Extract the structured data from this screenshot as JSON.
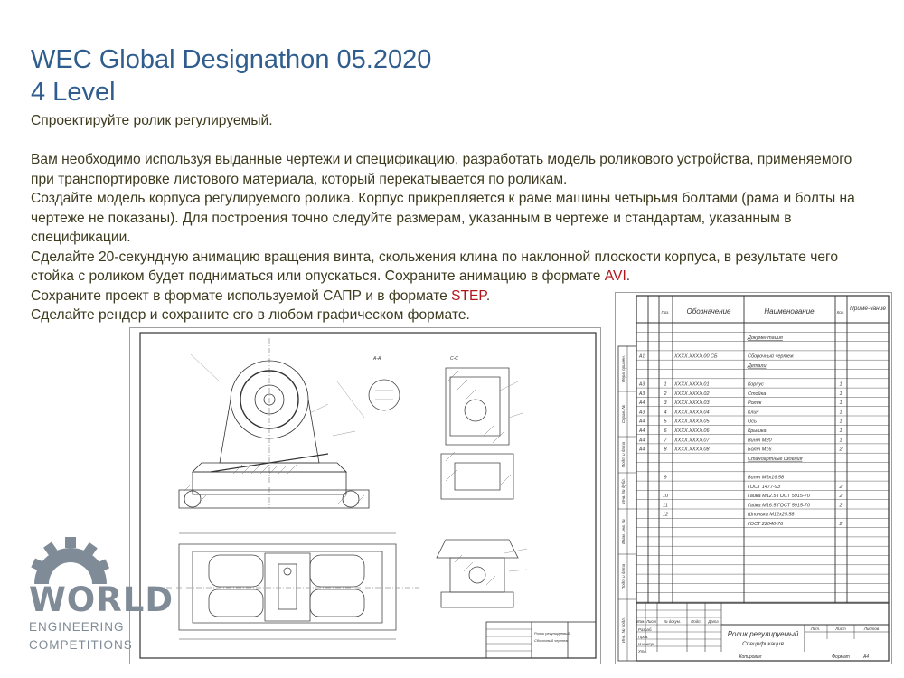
{
  "header": {
    "title_line1": "WEC Global Designathon 05.2020",
    "title_line2": "4 Level"
  },
  "task": {
    "intro": "Спроектируйте ролик регулируемый.",
    "p1": "Вам необходимо используя выданные чертежи и спецификацию, разработать модель роликового устройства, применяемого при транспортировке листового материала, который перекатывается по роликам.",
    "p2": "Создайте модель корпуса регулируемого ролика. Корпус прикрепляется к раме машины четырьмя болтами (рама и болты на чертеже не показаны). Для построения точно следуйте размерам, указанным в чертеже и стандартам, указанным в спецификации.",
    "p3_before": "Сделайте 20-секундную анимацию вращения винта, скольжения клина по наклонной плоскости корпуса, в результате чего стойка с роликом будет подниматься или опускаться. Сохраните анимацию в формате ",
    "p3_accent": "AVI",
    "p3_after": ".",
    "p4_before": "Сохраните проект в формате используемой САПР и в формате ",
    "p4_accent": "STEP",
    "p4_after": ".",
    "p5": "Сделайте рендер и сохраните его в любом графическом формате."
  },
  "colors": {
    "title": "#2f5d8e",
    "text": "#3d3a1e",
    "accent": "#b0161c",
    "logo": "#7f8b96"
  },
  "drawing": {
    "section_aa": "А-А",
    "section_cc": "С-С",
    "stamp_name": "Ролик регулируемый",
    "stamp_sub": "Сборочный чертеж"
  },
  "spec": {
    "headers": {
      "designation": "Обозначение",
      "name": "Наименование",
      "qty": "Кол.",
      "note": "Приме-чание",
      "pos": "Поз."
    },
    "side_labels": [
      "Перв. примен.",
      "Справ. №",
      "Подп. и дата",
      "Инв. № дубл.",
      "Взам. инв. №",
      "Подп. и дата",
      "Инв. № подл."
    ],
    "rows": [
      {
        "pos": "",
        "des": "",
        "name": "Документация",
        "qty": "",
        "hdr": true
      },
      {
        "pos": "",
        "des": "ХХХХ.ХХХХ.00 СБ",
        "name": "Сборочный чертеж",
        "qty": "",
        "fmt": "А1"
      },
      {
        "pos": "",
        "des": "",
        "name": "Детали",
        "qty": "",
        "hdr": true
      },
      {
        "pos": "1",
        "des": "ХХХХ.ХХХХ.01",
        "name": "Корпус",
        "qty": "1",
        "fmt": "А3"
      },
      {
        "pos": "2",
        "des": "ХХХХ.ХХХХ.02",
        "name": "Стойка",
        "qty": "1",
        "fmt": "А3"
      },
      {
        "pos": "3",
        "des": "ХХХХ.ХХХХ.03",
        "name": "Ролик",
        "qty": "1",
        "fmt": "А4"
      },
      {
        "pos": "4",
        "des": "ХХХХ.ХХХХ.04",
        "name": "Клин",
        "qty": "1",
        "fmt": "А3"
      },
      {
        "pos": "5",
        "des": "ХХХХ.ХХХХ.05",
        "name": "Ось",
        "qty": "1",
        "fmt": "А4"
      },
      {
        "pos": "6",
        "des": "ХХХХ.ХХХХ.06",
        "name": "Крышка",
        "qty": "1",
        "fmt": "А4"
      },
      {
        "pos": "7",
        "des": "ХХХХ.ХХХХ.07",
        "name": "Винт М20",
        "qty": "1",
        "fmt": "А4"
      },
      {
        "pos": "8",
        "des": "ХХХХ.ХХХХ.08",
        "name": "Болт М16",
        "qty": "2",
        "fmt": "А4"
      },
      {
        "pos": "",
        "des": "",
        "name": "Стандартные изделия",
        "qty": "",
        "hdr": true
      },
      {
        "pos": "9",
        "des": "",
        "name": "Винт М6х16.58",
        "qty": ""
      },
      {
        "pos": "",
        "des": "",
        "name": "ГОСТ 1477-93",
        "qty": "2"
      },
      {
        "pos": "10",
        "des": "",
        "name": "Гайка М12.5 ГОСТ 5915-70",
        "qty": "2"
      },
      {
        "pos": "11",
        "des": "",
        "name": "Гайка М16.5 ГОСТ 5915-70",
        "qty": "2"
      },
      {
        "pos": "12",
        "des": "",
        "name": "Шпилька М12х25.58",
        "qty": ""
      },
      {
        "pos": "",
        "des": "",
        "name": "ГОСТ 22040-76",
        "qty": "2"
      }
    ],
    "stamp": {
      "title": "Ролик регулируемый",
      "subtitle": "Спецификация",
      "cols": [
        "Изм.",
        "Лист",
        "№ докум.",
        "Подп.",
        "Дата"
      ],
      "roles": [
        "Разраб.",
        "Пров.",
        "Н.контр.",
        "Утв."
      ],
      "lit": "Лит.",
      "sheet": "Лист",
      "sheets": "Листов",
      "copied": "Копировал",
      "format": "Формат",
      "format_value": "А4"
    }
  },
  "logo": {
    "word1": "WORLD",
    "word2": "ENGINEERING",
    "word3": "COMPETITIONS"
  }
}
